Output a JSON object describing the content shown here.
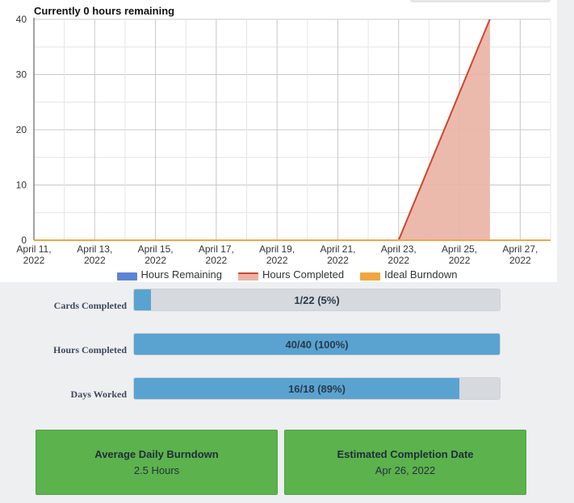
{
  "chart_data": {
    "type": "area",
    "title": "Currently 0 hours remaining",
    "x_axis": {
      "type": "date",
      "range": [
        "2022-04-11",
        "2022-04-28"
      ],
      "tick_labels": [
        "April 11,\n2022",
        "April 13,\n2022",
        "April 15,\n2022",
        "April 17,\n2022",
        "April 19,\n2022",
        "April 21,\n2022",
        "April 23,\n2022",
        "April 25,\n2022",
        "April 27,\n2022"
      ]
    },
    "y_axis": {
      "range": [
        0,
        40
      ],
      "ticks": [
        0,
        10,
        20,
        30,
        40
      ]
    },
    "grid": true,
    "legend_position": "bottom",
    "series": [
      {
        "name": "Hours Remaining",
        "color": "#5b84d6",
        "x": [
          "2022-04-11",
          "2022-04-26"
        ],
        "y": [
          0,
          0
        ]
      },
      {
        "name": "Hours Completed",
        "color": "#d1452a",
        "fill": "#e9b2a4",
        "x": [
          "2022-04-11",
          "2022-04-23",
          "2022-04-26"
        ],
        "y": [
          0,
          0,
          40
        ]
      },
      {
        "name": "Ideal Burndown",
        "color": "#f0a640",
        "x": [
          "2022-04-11",
          "2022-04-28"
        ],
        "y": [
          0,
          0
        ]
      }
    ]
  },
  "stats": [
    {
      "label": "Cards Completed",
      "text": "1/22 (5%)",
      "fraction": 0.0455
    },
    {
      "label": "Hours Completed",
      "text": "40/40 (100%)",
      "fraction": 1.0
    },
    {
      "label": "Days Worked",
      "text": "16/18 (89%)",
      "fraction": 0.889
    }
  ],
  "cards": [
    {
      "title": "Average Daily Burndown",
      "value": "2.5 Hours"
    },
    {
      "title": "Estimated Completion Date",
      "value": "Apr 26, 2022"
    }
  ]
}
